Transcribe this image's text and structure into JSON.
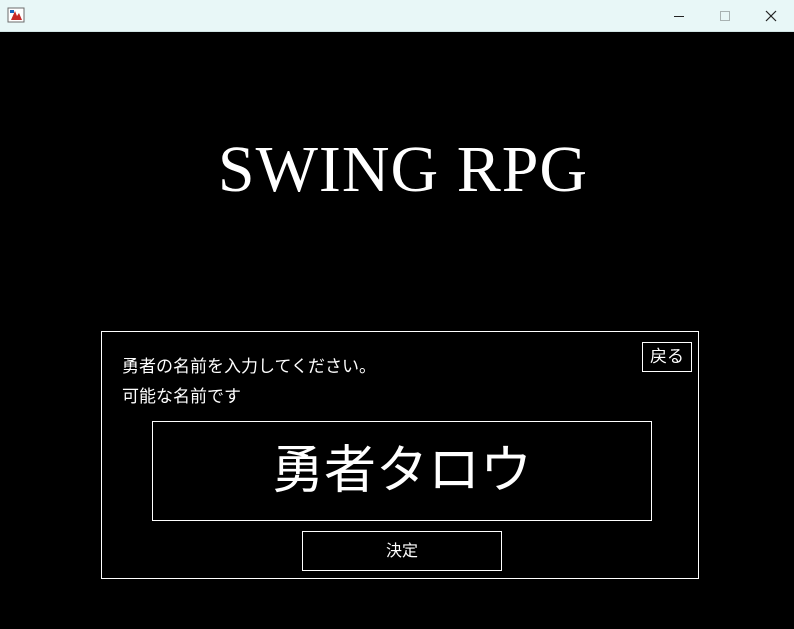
{
  "window": {
    "controls": {
      "minimize_icon": "minimize-icon",
      "maximize_icon": "maximize-icon",
      "close_icon": "close-icon"
    }
  },
  "title": "SWING RPG",
  "name_panel": {
    "back_label": "戻る",
    "prompt": "勇者の名前を入力してください。",
    "status": "可能な名前です",
    "name_value": "勇者タロウ",
    "confirm_label": "決定"
  },
  "colors": {
    "background": "#000000",
    "foreground": "#ffffff",
    "titlebar": "#e8f7f7"
  }
}
